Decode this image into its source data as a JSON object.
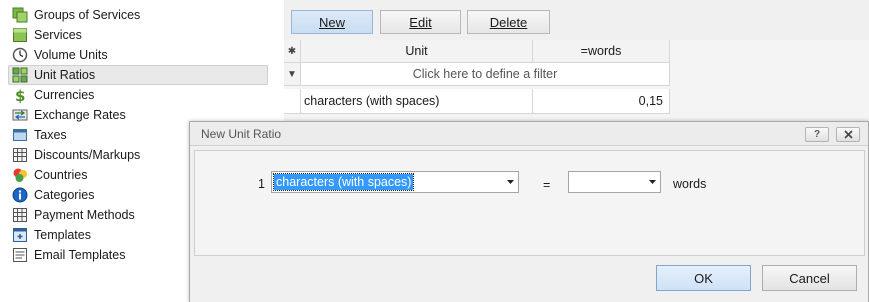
{
  "sidebar": {
    "items": [
      {
        "label": "Groups of Services",
        "icon": "groups-of-services-icon"
      },
      {
        "label": "Services",
        "icon": "services-icon"
      },
      {
        "label": "Volume Units",
        "icon": "volume-units-icon"
      },
      {
        "label": "Unit Ratios",
        "icon": "unit-ratios-icon",
        "selected": true
      },
      {
        "label": "Currencies",
        "icon": "currencies-icon"
      },
      {
        "label": "Exchange Rates",
        "icon": "exchange-rates-icon"
      },
      {
        "label": "Taxes",
        "icon": "taxes-icon"
      },
      {
        "label": "Discounts/Markups",
        "icon": "discounts-markups-icon"
      },
      {
        "label": "Countries",
        "icon": "countries-icon"
      },
      {
        "label": "Categories",
        "icon": "categories-icon"
      },
      {
        "label": "Payment Methods",
        "icon": "payment-methods-icon"
      },
      {
        "label": "Templates",
        "icon": "templates-icon"
      },
      {
        "label": "Email Templates",
        "icon": "email-templates-icon"
      }
    ]
  },
  "toolbar": {
    "new_label": "New",
    "edit_label": "Edit",
    "delete_label": "Delete"
  },
  "grid": {
    "columns": [
      "Unit",
      "=words"
    ],
    "filter_placeholder": "Click here to define a filter",
    "rows": [
      {
        "unit": "characters (with spaces)",
        "ratio": "0,15"
      }
    ]
  },
  "dialog": {
    "title": "New Unit Ratio",
    "help_label": "?",
    "row_number": "1",
    "source_unit": "characters (with spaces)",
    "equals": "=",
    "target_unit": "",
    "target_suffix": "words",
    "ok_label": "OK",
    "cancel_label": "Cancel"
  },
  "colors": {
    "selection": "#3399ff",
    "selected_nav_bg": "#e9e9e9",
    "primary_button": "#cfe2f6"
  }
}
